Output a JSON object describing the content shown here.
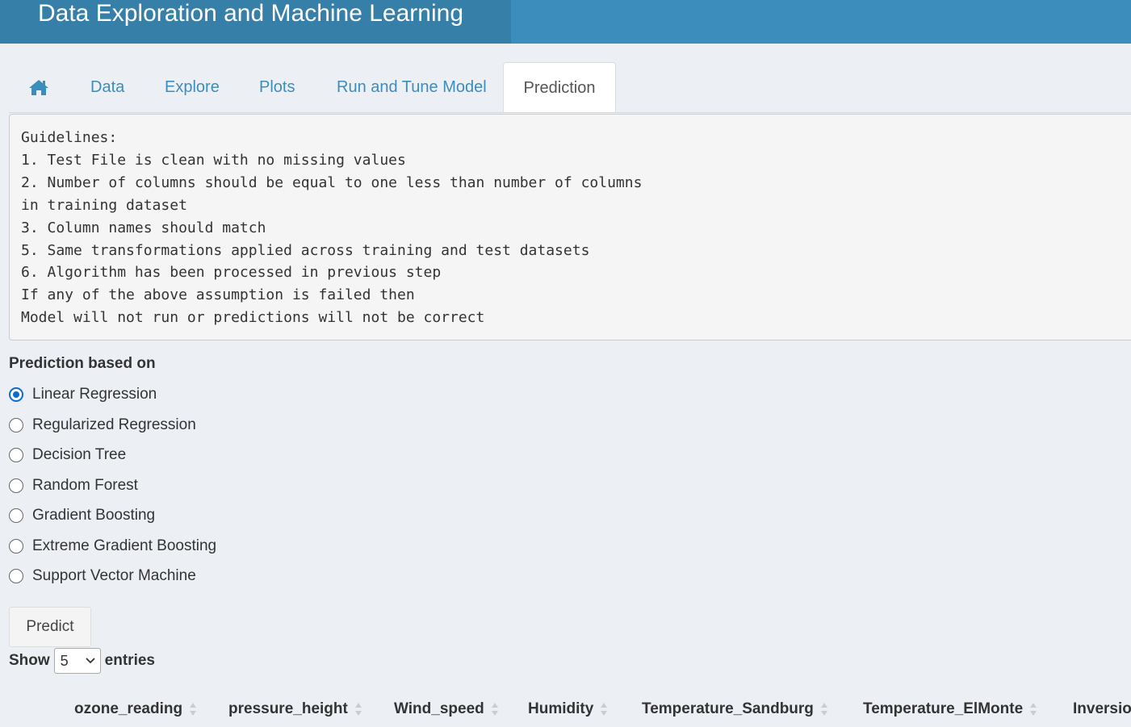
{
  "app": {
    "title": "Data Exploration and Machine Learning"
  },
  "tabs": [
    {
      "label": "",
      "icon": "home-icon"
    },
    {
      "label": "Data"
    },
    {
      "label": "Explore"
    },
    {
      "label": "Plots"
    },
    {
      "label": "Run and Tune Model"
    },
    {
      "label": "Prediction",
      "active": true
    }
  ],
  "guidelines": {
    "text": "Guidelines:\n1. Test File is clean with no missing values\n2. Number of columns should be equal to one less than number of columns\nin training dataset\n3. Column names should match\n5. Same transformations applied across training and test datasets\n6. Algorithm has been processed in previous step\nIf any of the above assumption is failed then\nModel will not run or predictions will not be correct"
  },
  "prediction": {
    "label": "Prediction based on",
    "options": [
      {
        "label": "Linear Regression",
        "checked": true
      },
      {
        "label": "Regularized Regression",
        "checked": false
      },
      {
        "label": "Decision Tree",
        "checked": false
      },
      {
        "label": "Random Forest",
        "checked": false
      },
      {
        "label": "Gradient Boosting",
        "checked": false
      },
      {
        "label": "Extreme Gradient Boosting",
        "checked": false
      },
      {
        "label": "Support Vector Machine",
        "checked": false
      }
    ],
    "button_label": "Predict"
  },
  "table": {
    "show_label": "Show",
    "entries_value": "5",
    "entries_label": "entries",
    "columns": [
      "ozone_reading",
      "pressure_height",
      "Wind_speed",
      "Humidity",
      "Temperature_Sandburg",
      "Temperature_ElMonte",
      "Inversio"
    ]
  },
  "colors": {
    "header_bg": "#3c8dbc",
    "header_title_bg": "#367fa9",
    "tab_link": "#3c8dbc",
    "radio_checked": "#0b6bd4"
  }
}
